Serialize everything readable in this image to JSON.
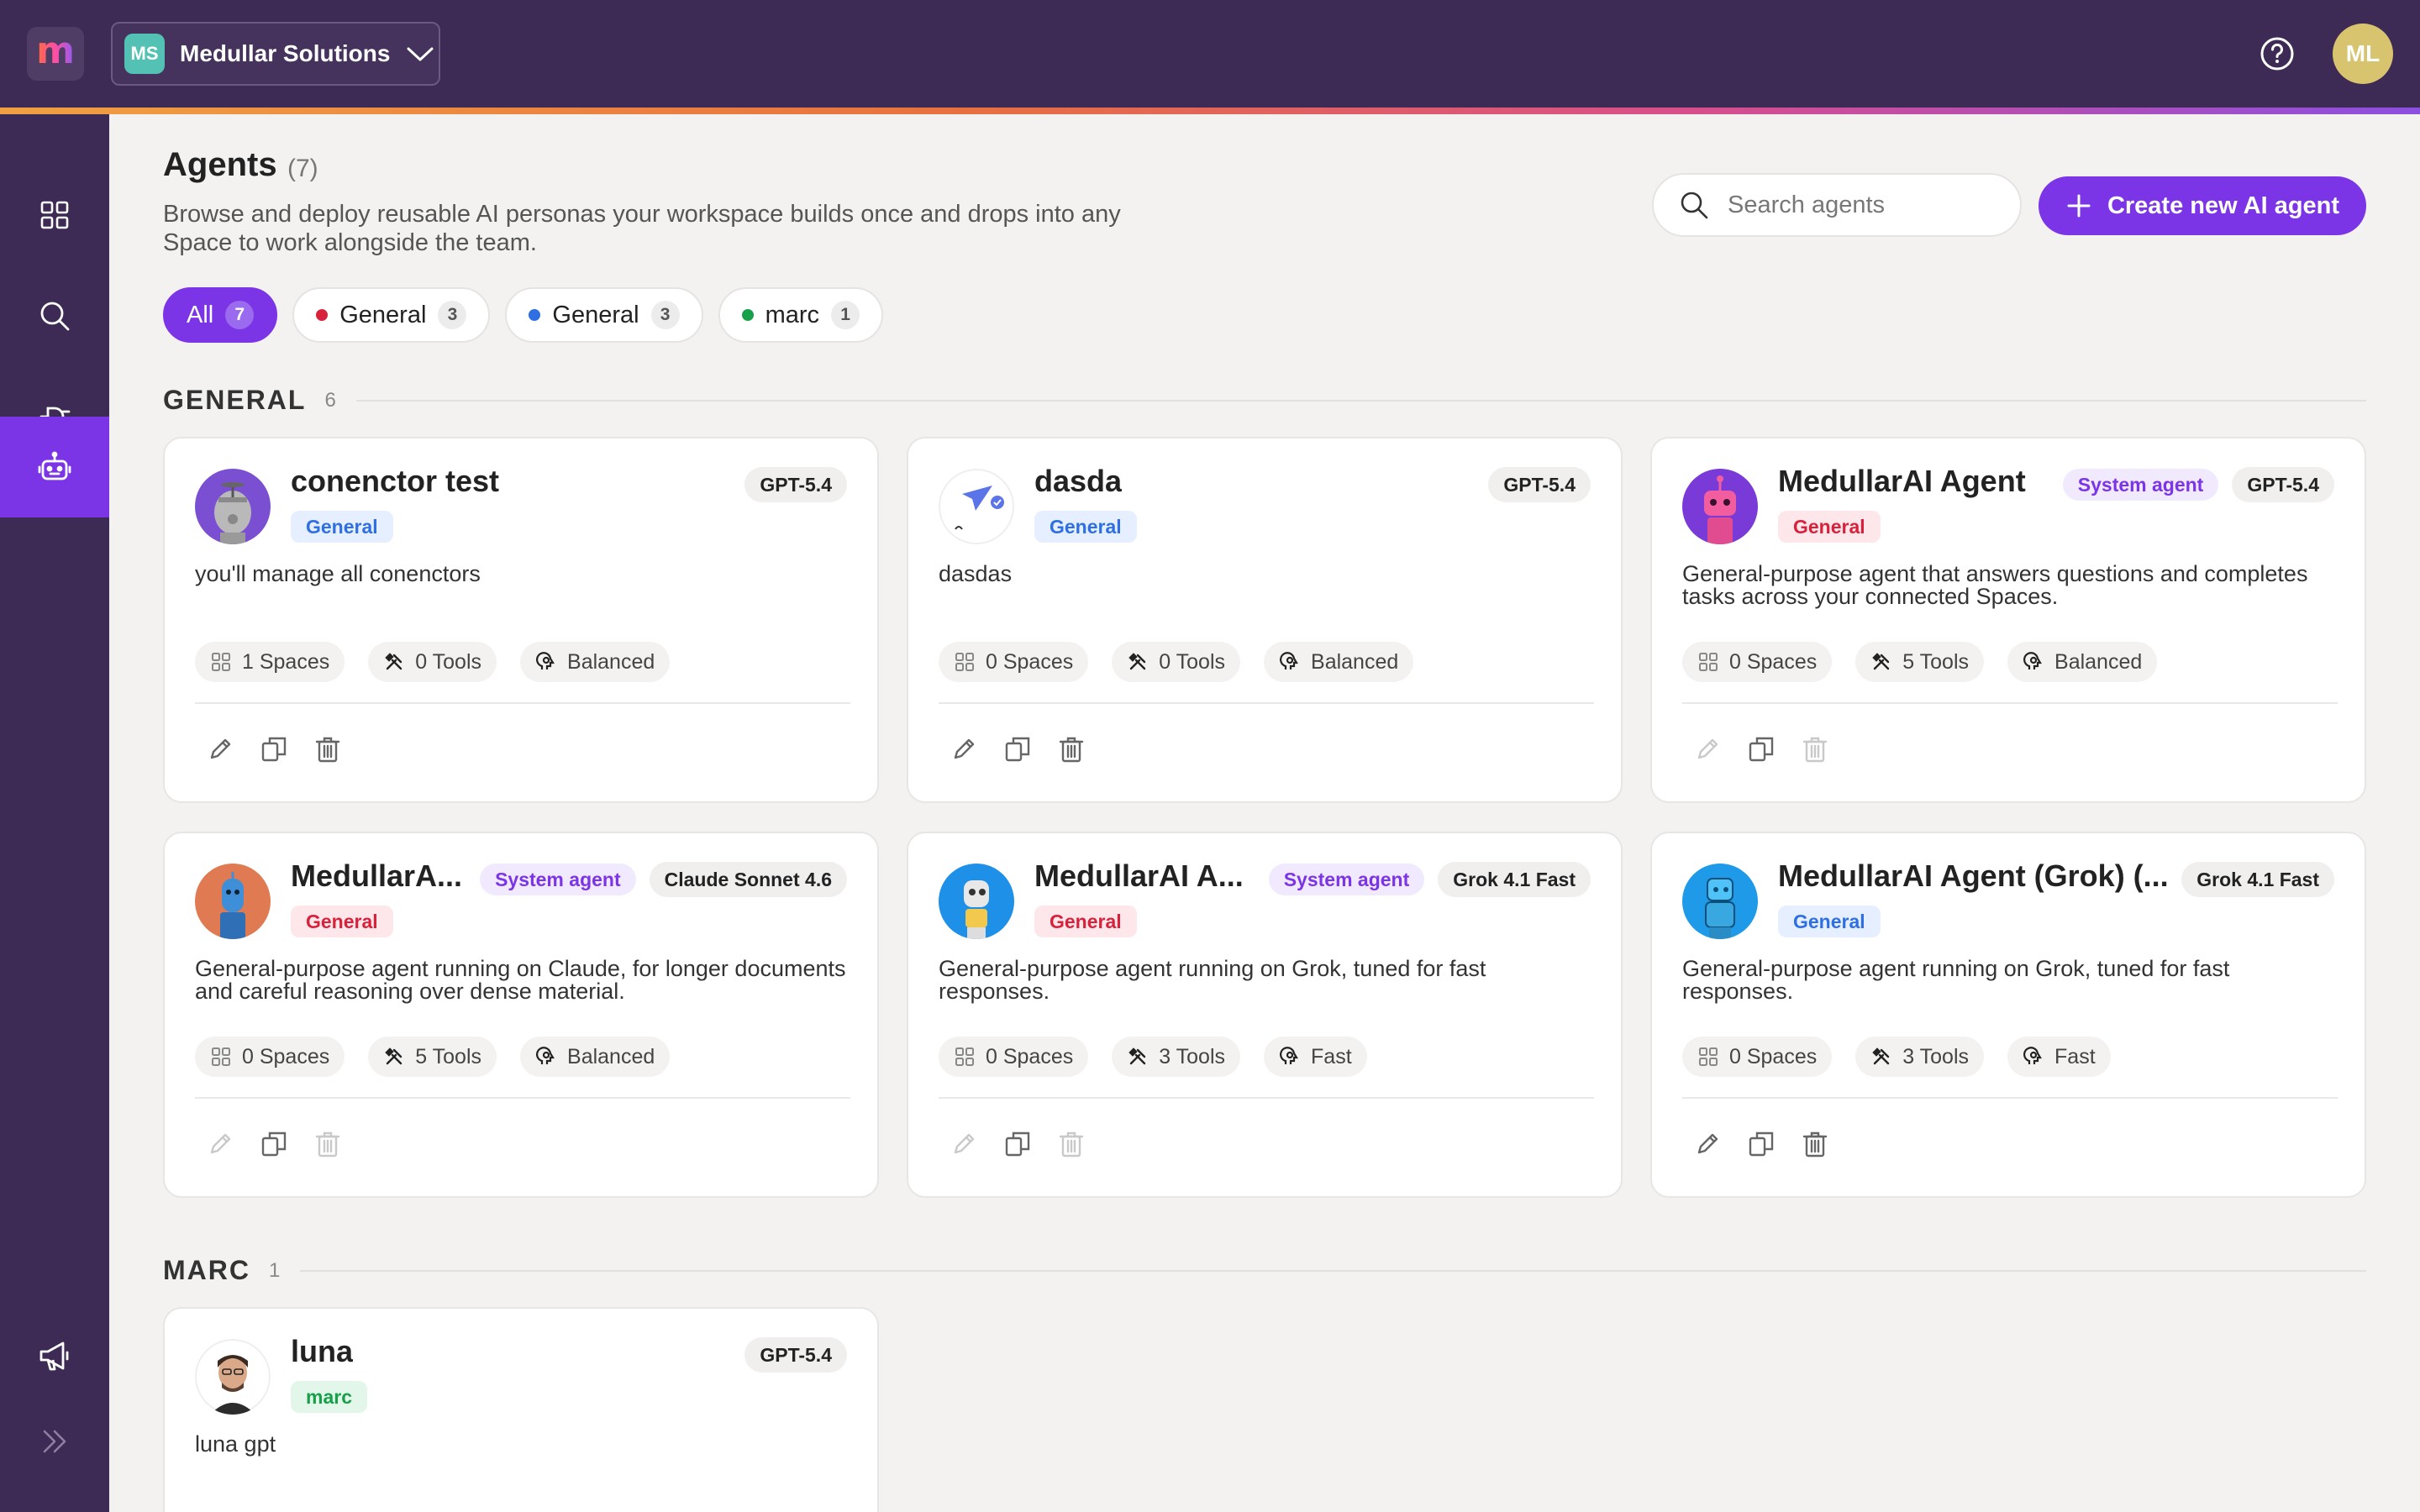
{
  "topbar": {
    "logo_icon": "m-logo-icon",
    "org": {
      "initials": "MS",
      "name": "Medullar Solutions"
    },
    "user_initials": "ML"
  },
  "sidebar": {
    "items": [
      {
        "icon": "grid-icon",
        "active": false
      },
      {
        "icon": "search-icon",
        "active": false
      },
      {
        "icon": "plug-icon",
        "active": false
      },
      {
        "icon": "robot-icon",
        "active": true
      },
      {
        "icon": "megaphone-icon",
        "active": false
      },
      {
        "icon": "expand-icon",
        "active": false
      }
    ]
  },
  "page": {
    "title": "Agents",
    "count": "(7)",
    "description": "Browse and deploy reusable AI personas your workspace builds once and drops into any Space to work alongside the team."
  },
  "search": {
    "placeholder": "Search agents"
  },
  "create_button": "Create new AI agent",
  "filters": [
    {
      "label": "All",
      "count": "7",
      "active": true,
      "dot": ""
    },
    {
      "label": "General",
      "count": "3",
      "active": false,
      "dot": "#d8223b"
    },
    {
      "label": "General",
      "count": "3",
      "active": false,
      "dot": "#2f6fe4"
    },
    {
      "label": "marc",
      "count": "1",
      "active": false,
      "dot": "#15a049"
    }
  ],
  "sections": [
    {
      "label": "GENERAL",
      "count": "6",
      "cards": [
        {
          "name": "conenctor test",
          "system": "",
          "model": "GPT-5.4",
          "category": "General",
          "cat_color": "blue",
          "description": "you'll manage all conenctors",
          "spaces": "1 Spaces",
          "tools": "0 Tools",
          "mode": "Balanced",
          "avatar": "robot-gray-avatar",
          "actions": "full"
        },
        {
          "name": "dasda",
          "system": "",
          "model": "GPT-5.4",
          "category": "General",
          "cat_color": "blue",
          "description": "dasdas",
          "spaces": "0 Spaces",
          "tools": "0 Tools",
          "mode": "Balanced",
          "avatar": "paper-plane-avatar",
          "actions": "full"
        },
        {
          "name": "MedullarAI Agent",
          "system": "System agent",
          "model": "GPT-5.4",
          "category": "General",
          "cat_color": "red",
          "description": "General-purpose agent that answers questions and completes tasks across your connected Spaces.",
          "spaces": "0 Spaces",
          "tools": "5 Tools",
          "mode": "Balanced",
          "avatar": "robot-pink-avatar",
          "actions": "half"
        },
        {
          "name": "MedullarA...",
          "system": "System agent",
          "model": "Claude Sonnet 4.6",
          "category": "General",
          "cat_color": "red",
          "description": "General-purpose agent running on Claude, for longer documents and careful reasoning over dense material.",
          "spaces": "0 Spaces",
          "tools": "5 Tools",
          "mode": "Balanced",
          "avatar": "robot-orange-avatar",
          "actions": "half"
        },
        {
          "name": "MedullarAI A...",
          "system": "System agent",
          "model": "Grok 4.1 Fast",
          "category": "General",
          "cat_color": "red",
          "description": "General-purpose agent running on Grok, tuned for fast responses.",
          "spaces": "0 Spaces",
          "tools": "3 Tools",
          "mode": "Fast",
          "avatar": "robot-blue-avatar",
          "actions": "half"
        },
        {
          "name": "MedullarAI Agent (Grok) (...",
          "system": "",
          "model": "Grok 4.1 Fast",
          "category": "General",
          "cat_color": "blue",
          "description": "General-purpose agent running on Grok, tuned for fast responses.",
          "spaces": "0 Spaces",
          "tools": "3 Tools",
          "mode": "Fast",
          "avatar": "robot-cyan-avatar",
          "actions": "full"
        }
      ]
    },
    {
      "label": "MARC",
      "count": "1",
      "cards": [
        {
          "name": "luna",
          "system": "",
          "model": "GPT-5.4",
          "category": "marc",
          "cat_color": "green",
          "description": "luna gpt",
          "spaces": "",
          "tools": "",
          "mode": "",
          "avatar": "person-avatar",
          "actions": "full"
        }
      ]
    }
  ]
}
